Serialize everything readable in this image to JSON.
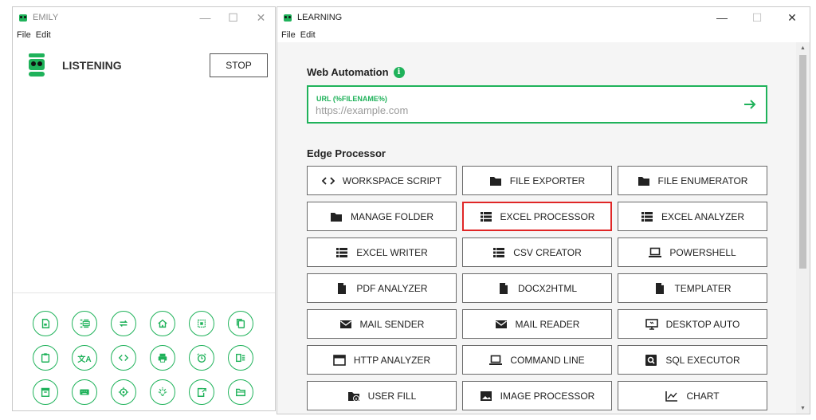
{
  "emily": {
    "title": "EMILY",
    "menu": [
      "File",
      "Edit"
    ],
    "status_label": "LISTENING",
    "stop_label": "STOP",
    "tool_icons": [
      "document-icon",
      "list-icon",
      "repeat-icon",
      "home-icon",
      "frame-icon",
      "copy-icon",
      "clipboard-icon",
      "translate-icon",
      "code-icon",
      "print-icon",
      "alarm-icon",
      "database-list-icon",
      "archive-icon",
      "keyboard-icon",
      "crosshair-icon",
      "lightbulb-icon",
      "file-export-icon",
      "folder-open-icon"
    ]
  },
  "learning": {
    "title": "LEARNING",
    "menu": [
      "File",
      "Edit"
    ],
    "web_automation": {
      "title": "Web Automation",
      "info_glyph": "i",
      "url_label": "URL (%FILENAME%)",
      "url_placeholder": "https://example.com"
    },
    "edge_processor": {
      "title": "Edge Processor",
      "buttons": [
        {
          "label": "WORKSPACE SCRIPT",
          "icon": "code-icon"
        },
        {
          "label": "FILE EXPORTER",
          "icon": "folder-icon"
        },
        {
          "label": "FILE ENUMERATOR",
          "icon": "folder-icon"
        },
        {
          "label": "MANAGE FOLDER",
          "icon": "folder-icon"
        },
        {
          "label": "EXCEL PROCESSOR",
          "icon": "list-icon",
          "selected": true
        },
        {
          "label": "EXCEL ANALYZER",
          "icon": "list-icon"
        },
        {
          "label": "EXCEL WRITER",
          "icon": "list-icon"
        },
        {
          "label": "CSV CREATOR",
          "icon": "list-icon"
        },
        {
          "label": "POWERSHELL",
          "icon": "laptop-icon"
        },
        {
          "label": "PDF ANALYZER",
          "icon": "file-icon"
        },
        {
          "label": "DOCX2HTML",
          "icon": "file-icon"
        },
        {
          "label": "TEMPLATER",
          "icon": "file-icon"
        },
        {
          "label": "MAIL SENDER",
          "icon": "mail-icon"
        },
        {
          "label": "MAIL READER",
          "icon": "mail-icon"
        },
        {
          "label": "DESKTOP AUTO",
          "icon": "monitor-icon"
        },
        {
          "label": "HTTP ANALYZER",
          "icon": "browser-window-icon"
        },
        {
          "label": "COMMAND LINE",
          "icon": "laptop-icon"
        },
        {
          "label": "SQL EXECUTOR",
          "icon": "database-search-icon"
        },
        {
          "label": "USER FILL",
          "icon": "folder-info-icon"
        },
        {
          "label": "IMAGE PROCESSOR",
          "icon": "image-icon"
        },
        {
          "label": "CHART",
          "icon": "line-chart-icon"
        }
      ]
    }
  },
  "colors": {
    "accent": "#1fb25a",
    "selected_border": "#e02626"
  }
}
